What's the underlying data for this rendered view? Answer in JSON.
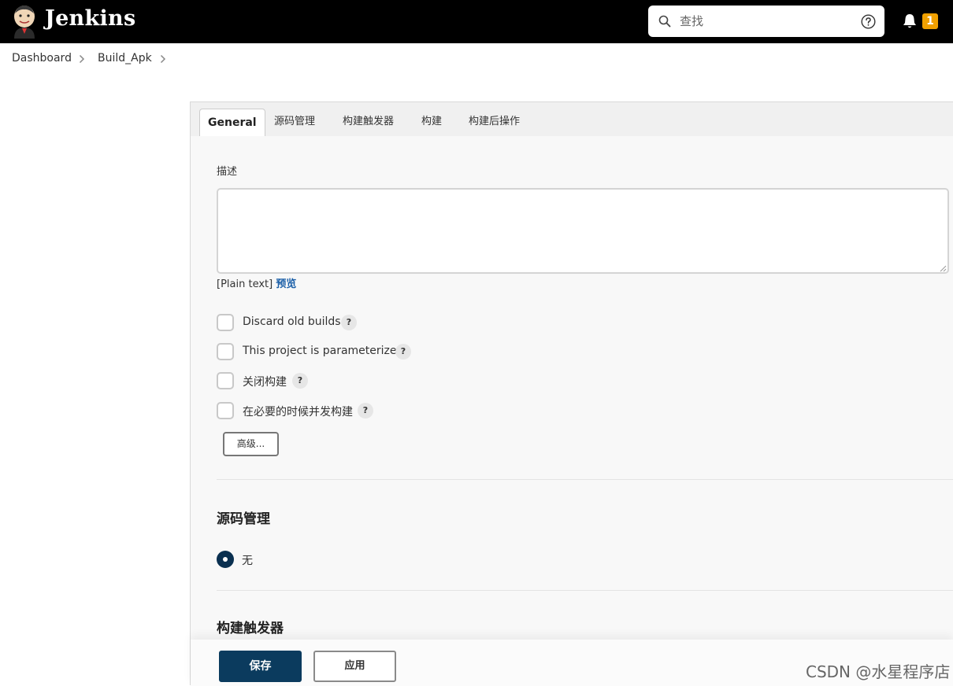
{
  "header": {
    "brand": "Jenkins",
    "search_placeholder": "查找",
    "notification_count": "1"
  },
  "breadcrumb": [
    "Dashboard",
    "Build_Apk"
  ],
  "tabs": [
    "General",
    "源码管理",
    "构建触发器",
    "构建",
    "构建后操作"
  ],
  "general": {
    "description_label": "描述",
    "plain_text": "[Plain text]",
    "preview_link": "预览",
    "checkboxes": [
      {
        "label": "Discard old builds",
        "checked": false
      },
      {
        "label": "This project is parameterized",
        "checked": false
      },
      {
        "label": "关闭构建",
        "checked": false
      },
      {
        "label": "在必要的时候并发构建",
        "checked": false
      }
    ],
    "help_glyph": "?",
    "advanced_button": "高级..."
  },
  "scm": {
    "title": "源码管理",
    "options": [
      {
        "label": "无",
        "selected": true
      }
    ]
  },
  "triggers": {
    "title": "构建触发器"
  },
  "actions": {
    "save": "保存",
    "apply": "应用"
  },
  "watermark": "CSDN @水星程序店",
  "colors": {
    "header_bg": "#000000",
    "badge": "#f0a000",
    "primary": "#0b3b5e",
    "link": "#1b5fa8"
  }
}
